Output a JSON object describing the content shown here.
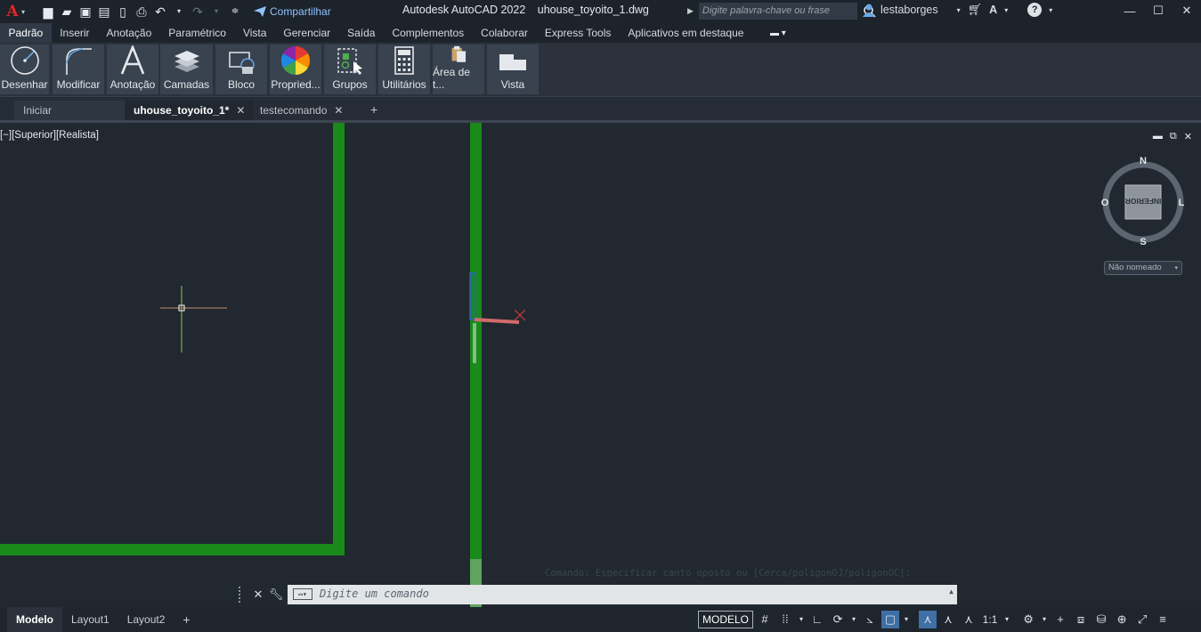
{
  "titlebar": {
    "logo": "A",
    "share": "Compartilhar",
    "app_title": "Autodesk AutoCAD 2022",
    "file_name": "uhouse_toyoito_1.dwg",
    "search_placeholder": "Digite palavra-chave ou frase",
    "user": "lestaborges"
  },
  "menu": {
    "items": [
      "Padrão",
      "Inserir",
      "Anotação",
      "Paramétrico",
      "Vista",
      "Gerenciar",
      "Saída",
      "Complementos",
      "Colaborar",
      "Express Tools",
      "Aplicativos em destaque"
    ]
  },
  "ribbon": {
    "buttons": [
      "Desenhar",
      "Modificar",
      "Anotação",
      "Camadas",
      "Bloco",
      "Propried...",
      "Grupos",
      "Utilitários",
      "Área de t...",
      "Vista"
    ]
  },
  "doctabs": {
    "start": "Iniciar",
    "active": "uhouse_toyoito_1*",
    "other": "testecomando"
  },
  "viewport": {
    "label": "[−][Superior][Realista]",
    "viewcube": {
      "n": "N",
      "s": "S",
      "e": "L",
      "w": "O",
      "face": "INFERIOR"
    },
    "ucs_name": "Não nomeado",
    "command_history": "Comando: Especificar canto oposto ou [Cerca/poligonOJ/poligonOC]:",
    "wall_color": "#1a8a1a"
  },
  "command": {
    "placeholder": "Digite um comando"
  },
  "status": {
    "layouts": [
      "Modelo",
      "Layout1",
      "Layout2"
    ],
    "model_label": "MODELO",
    "scale": "1:1"
  }
}
